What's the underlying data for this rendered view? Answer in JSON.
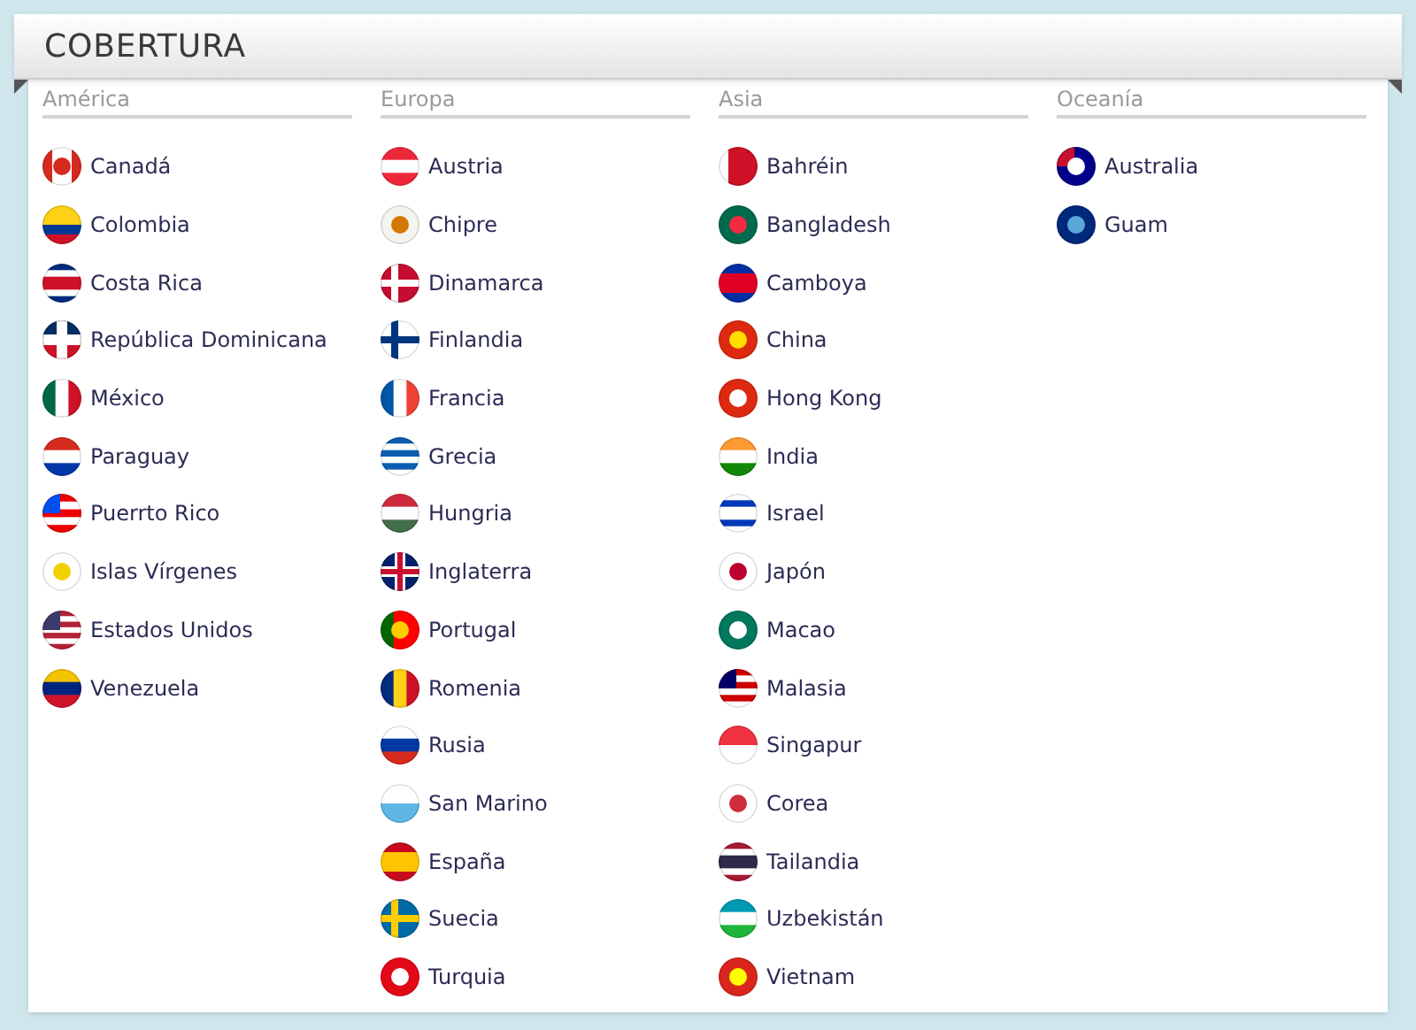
{
  "title": "COBERTURA",
  "regions": [
    {
      "name": "América",
      "countries": [
        "Canadá",
        "Colombia",
        "Costa Rica",
        "República Dominicana",
        "México",
        "Paraguay",
        "Puerrto Rico",
        "Islas Vírgenes",
        "Estados Unidos",
        "Venezuela"
      ]
    },
    {
      "name": "Europa",
      "countries": [
        "Austria",
        "Chipre",
        "Dinamarca",
        "Finlandia",
        "Francia",
        "Grecia",
        "Hungria",
        "Inglaterra",
        "Portugal",
        "Romenia",
        "Rusia",
        "San Marino",
        "España",
        "Suecia",
        "Turquia"
      ]
    },
    {
      "name": "Asia",
      "countries": [
        "Bahréin",
        "Bangladesh",
        "Camboya",
        "China",
        "Hong Kong",
        "India",
        "Israel",
        "Japón",
        "Macao",
        "Malasia",
        "Singapur",
        "Corea",
        "Tailandia",
        "Uzbekistán",
        "Vietnam"
      ]
    },
    {
      "name": "Oceanía",
      "countries": [
        "Australia",
        "Guam"
      ]
    }
  ]
}
